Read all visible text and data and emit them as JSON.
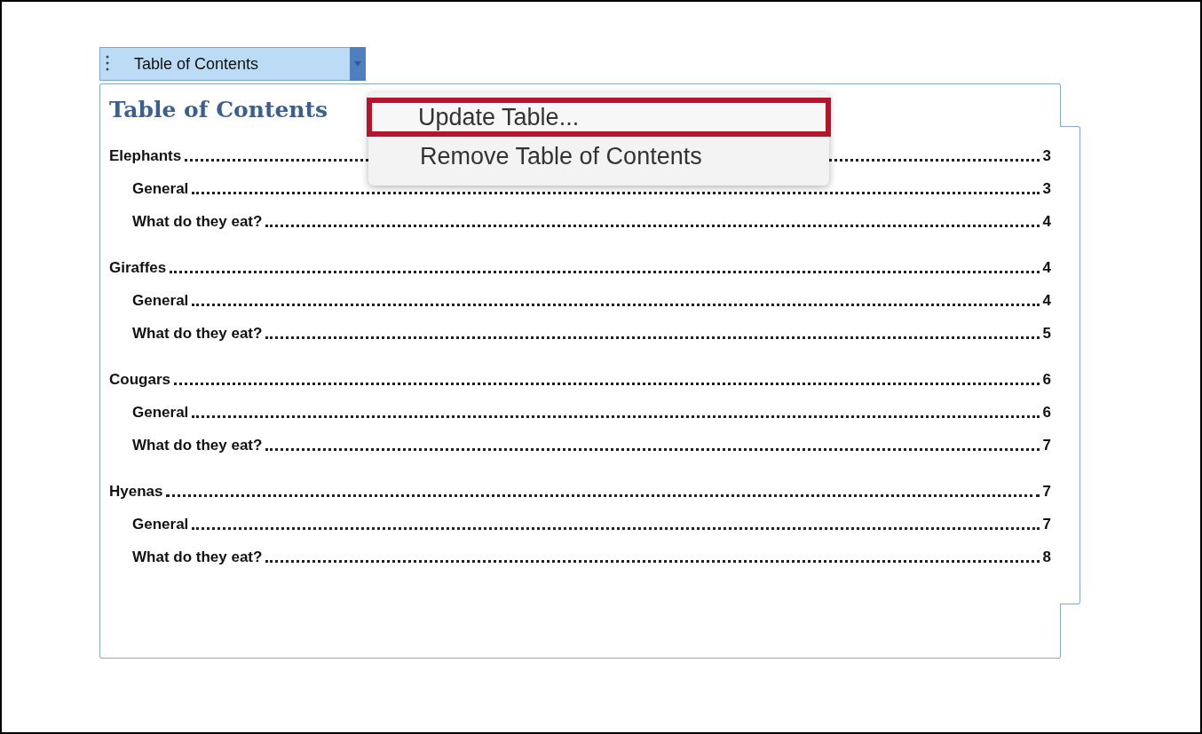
{
  "content_control": {
    "tab_label": "Table of Contents",
    "title": "Table of Contents",
    "entries": [
      {
        "text": "Elephants",
        "page": "3",
        "children": [
          {
            "text": "General",
            "page": "3"
          },
          {
            "text": "What do they eat?",
            "page": "4"
          }
        ]
      },
      {
        "text": "Giraffes",
        "page": "4",
        "children": [
          {
            "text": "General",
            "page": "4"
          },
          {
            "text": "What do they eat?",
            "page": "5"
          }
        ]
      },
      {
        "text": "Cougars",
        "page": "6",
        "children": [
          {
            "text": "General",
            "page": "6"
          },
          {
            "text": "What do they eat?",
            "page": "7"
          }
        ]
      },
      {
        "text": "Hyenas",
        "page": "7",
        "children": [
          {
            "text": "General",
            "page": "7"
          },
          {
            "text": "What do they eat?",
            "page": "8"
          }
        ]
      }
    ]
  },
  "context_menu": {
    "items": [
      {
        "label": "Update Table...",
        "selected": true
      },
      {
        "label": "Remove Table of Contents",
        "selected": false
      }
    ]
  }
}
